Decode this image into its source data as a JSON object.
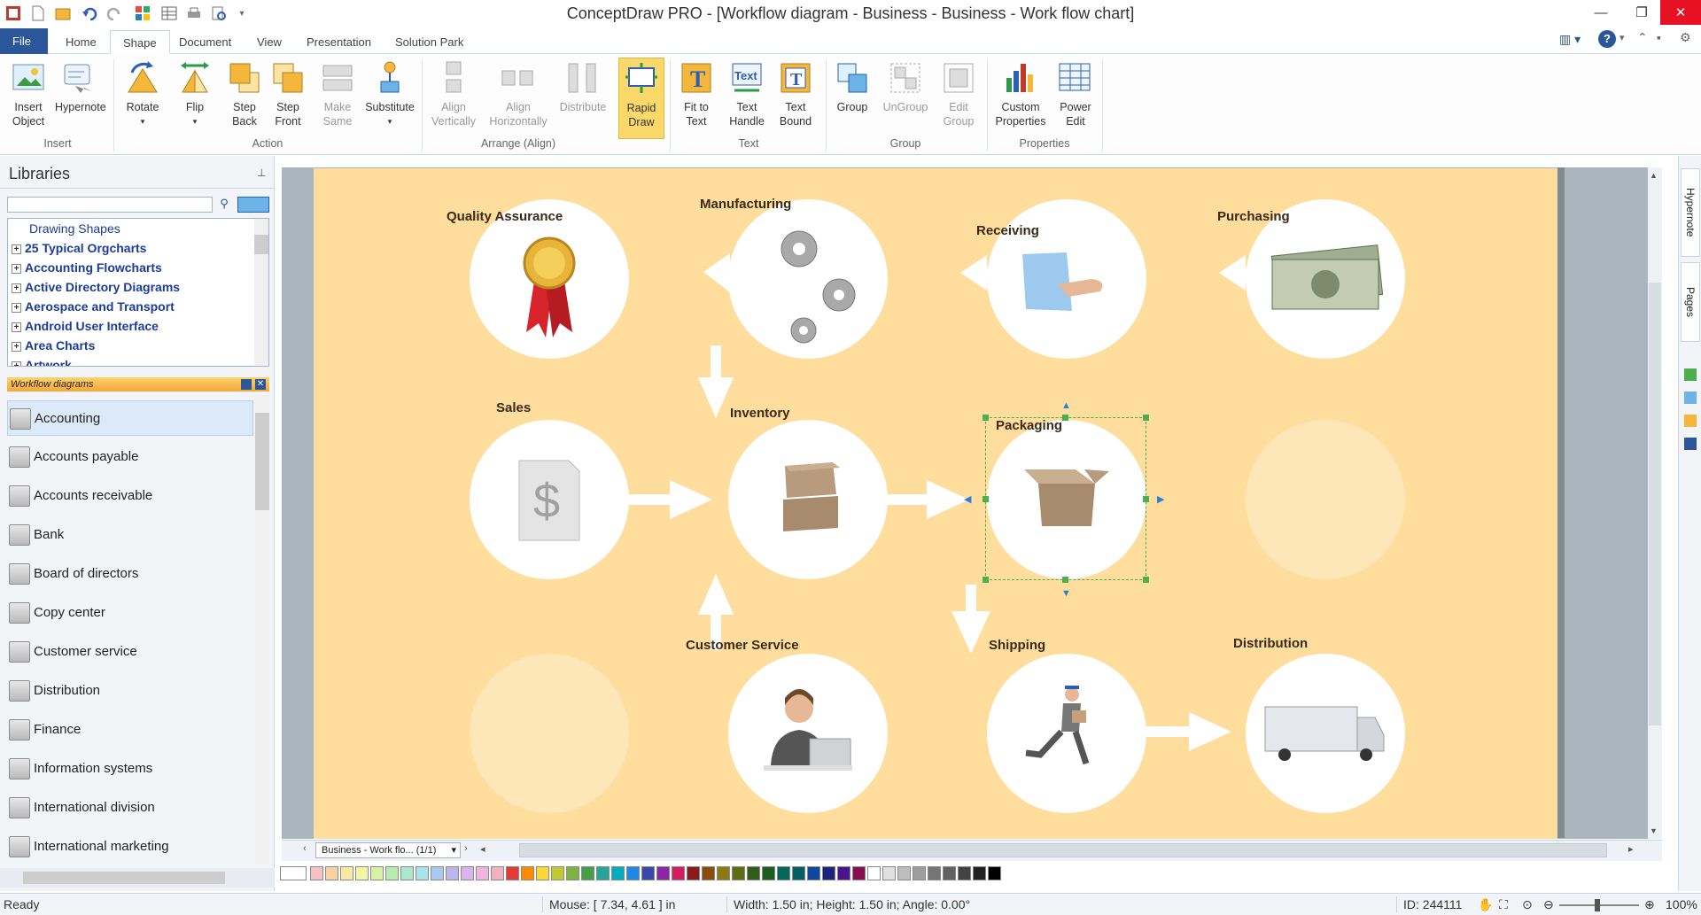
{
  "window": {
    "title": "ConceptDraw PRO - [Workflow diagram - Business - Business - Work flow chart]"
  },
  "tabs": [
    "File",
    "Home",
    "Shape",
    "Document",
    "View",
    "Presentation",
    "Solution Park"
  ],
  "active_tab": "Shape",
  "ribbon": {
    "insert_object": "Insert\nObject",
    "hypernote": "Hypernote",
    "rotate": "Rotate",
    "flip": "Flip",
    "step_back": "Step\nBack",
    "step_front": "Step\nFront",
    "make_same": "Make\nSame",
    "substitute": "Substitute",
    "align_vertically": "Align\nVertically",
    "align_horizontally": "Align\nHorizontally",
    "distribute": "Distribute",
    "rapid_draw": "Rapid\nDraw",
    "fit_to_text": "Fit to\nText",
    "text_handle": "Text\nHandle",
    "text_bound": "Text\nBound",
    "group": "Group",
    "ungroup": "UnGroup",
    "edit_group": "Edit\nGroup",
    "custom_properties": "Custom\nProperties",
    "power_edit": "Power\nEdit",
    "groups": {
      "insert": "Insert",
      "action": "Action",
      "arrange": "Arrange (Align)",
      "text": "Text",
      "group": "Group",
      "properties": "Properties"
    }
  },
  "libraries": {
    "title": "Libraries",
    "tree": [
      "Drawing Shapes",
      "25 Typical Orgcharts",
      "Accounting Flowcharts",
      "Active Directory Diagrams",
      "Aerospace and Transport",
      "Android User Interface",
      "Area Charts",
      "Artwork"
    ],
    "open_library": "Workflow diagrams",
    "shapes": [
      "Accounting",
      "Accounts payable",
      "Accounts receivable",
      "Bank",
      "Board of directors",
      "Copy center",
      "Customer service",
      "Distribution",
      "Finance",
      "Information systems",
      "International division",
      "International marketing"
    ]
  },
  "diagram": {
    "nodes": {
      "quality_assurance": "Quality Assurance",
      "manufacturing": "Manufacturing",
      "receiving": "Receiving",
      "purchasing": "Purchasing",
      "sales": "Sales",
      "inventory": "Inventory",
      "packaging": "Packaging",
      "customer_service": "Customer Service",
      "shipping": "Shipping",
      "distribution": "Distribution"
    }
  },
  "page_tab": "Business - Work flo... (1/1)",
  "right_tabs": [
    "Hypernote",
    "Pages"
  ],
  "status": {
    "ready": "Ready",
    "mouse": "Mouse: [ 7.34, 4.61 ] in",
    "size": "Width: 1.50 in;  Height: 1.50 in;  Angle: 0.00°",
    "id": "ID: 244111",
    "zoom": "100%"
  },
  "colors": {
    "accent": "#2b579a",
    "page": "#fedd9d",
    "canvas_bg": "#a9b6bd",
    "arrow": "#ffffff"
  }
}
